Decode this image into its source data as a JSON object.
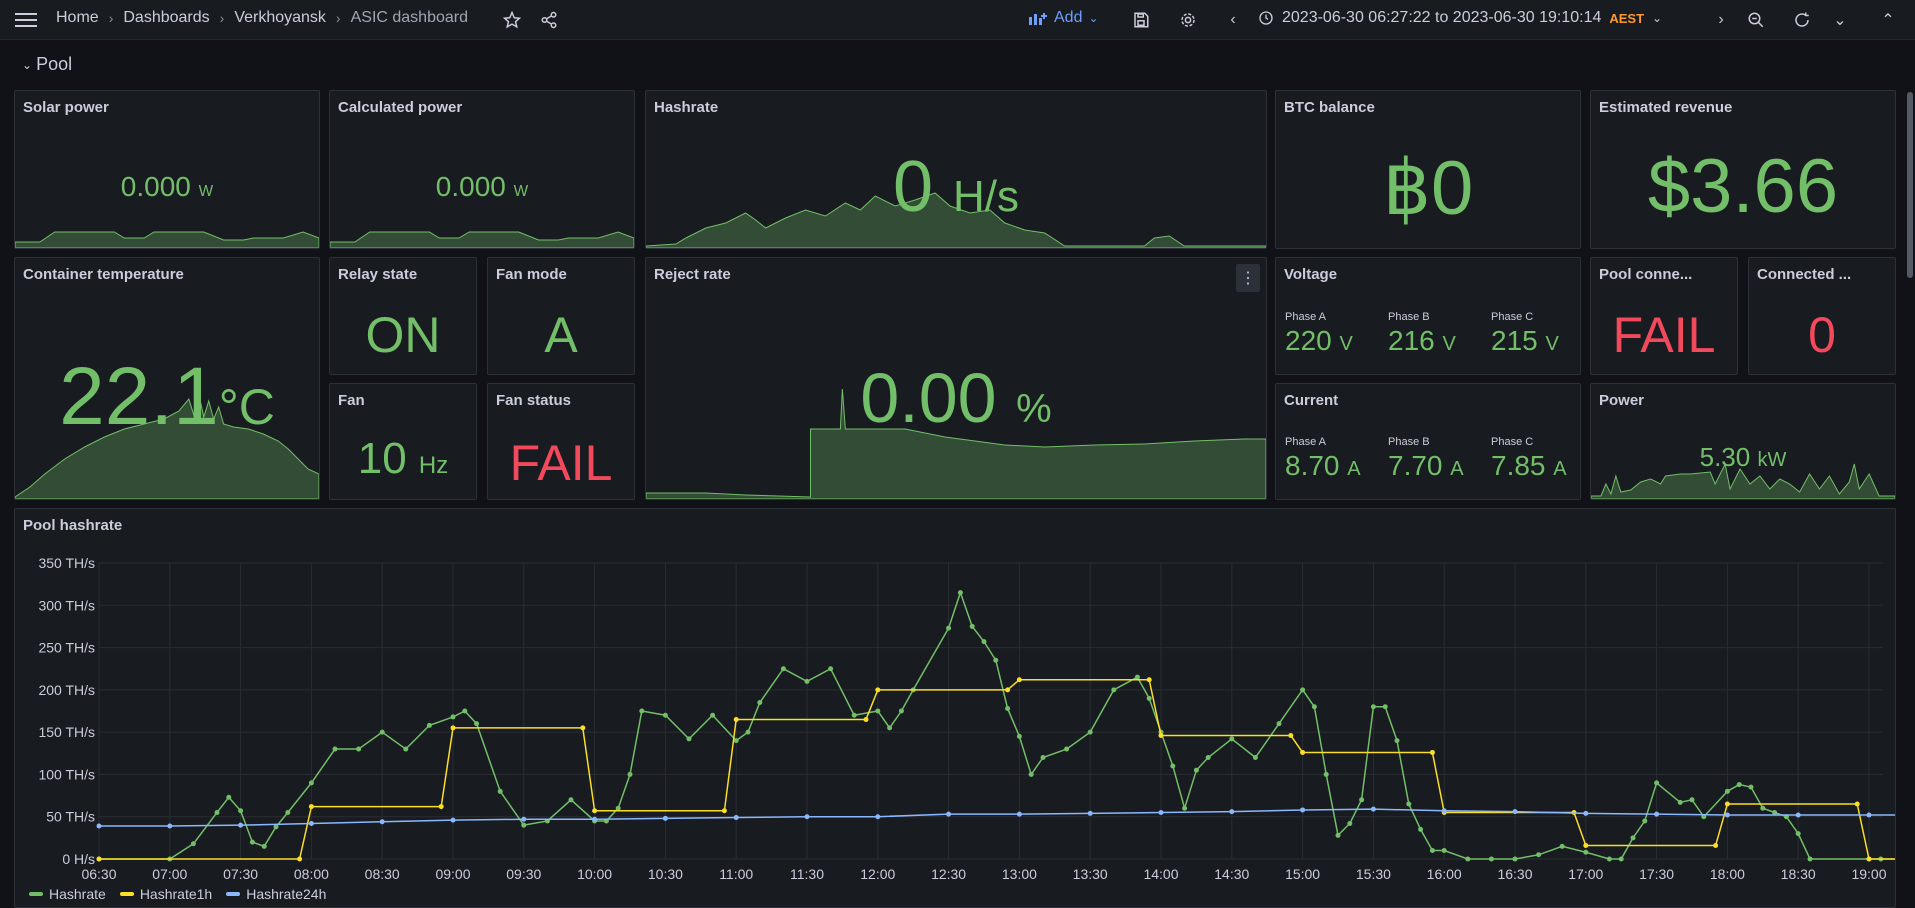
{
  "topbar": {
    "breadcrumbs": [
      "Home",
      "Dashboards",
      "Verkhoyansk",
      "ASIC dashboard"
    ],
    "add_label": "Add",
    "time_range": "2023-06-30 06:27:22 to 2023-06-30 19:10:14",
    "timezone": "AEST"
  },
  "row": {
    "title": "Pool"
  },
  "panels": {
    "solar_power": {
      "title": "Solar power",
      "value": "0.000",
      "unit": "W"
    },
    "calculated_power": {
      "title": "Calculated power",
      "value": "0.000",
      "unit": "W"
    },
    "hashrate": {
      "title": "Hashrate",
      "value": "0",
      "unit": "H/s"
    },
    "btc_balance": {
      "title": "BTC balance",
      "value": "฿0"
    },
    "estimated_revenue": {
      "title": "Estimated revenue",
      "value": "$3.66"
    },
    "container_temperature": {
      "title": "Container temperature",
      "value": "22.1",
      "unit": "°C"
    },
    "relay_state": {
      "title": "Relay state",
      "value": "ON"
    },
    "fan_mode": {
      "title": "Fan mode",
      "value": "A"
    },
    "fan": {
      "title": "Fan",
      "value": "10",
      "unit": "Hz"
    },
    "fan_status": {
      "title": "Fan status",
      "value": "FAIL"
    },
    "reject_rate": {
      "title": "Reject rate",
      "value": "0.00",
      "unit": "%"
    },
    "voltage": {
      "title": "Voltage",
      "phases": [
        {
          "label": "Phase A",
          "value": "220",
          "unit": "V"
        },
        {
          "label": "Phase B",
          "value": "216",
          "unit": "V"
        },
        {
          "label": "Phase C",
          "value": "215",
          "unit": "V"
        }
      ]
    },
    "current": {
      "title": "Current",
      "phases": [
        {
          "label": "Phase A",
          "value": "8.70",
          "unit": "A"
        },
        {
          "label": "Phase B",
          "value": "7.70",
          "unit": "A"
        },
        {
          "label": "Phase C",
          "value": "7.85",
          "unit": "A"
        }
      ]
    },
    "pool_connection": {
      "title": "Pool conne...",
      "value": "FAIL"
    },
    "connected": {
      "title": "Connected ...",
      "value": "0"
    },
    "power": {
      "title": "Power",
      "value": "5.30",
      "unit": "kW"
    }
  },
  "colors": {
    "green": "#73bf69",
    "red": "#f2495c",
    "yellow": "#fade2a",
    "blue": "#8ab8ff",
    "accent": "#6e9fff"
  },
  "chart_data": {
    "type": "line",
    "title": "Pool hashrate",
    "ylim": [
      0,
      350
    ],
    "yticks": [
      "0 H/s",
      "50 TH/s",
      "100 TH/s",
      "150 TH/s",
      "200 TH/s",
      "250 TH/s",
      "300 TH/s",
      "350 TH/s"
    ],
    "xticks": [
      "06:30",
      "07:00",
      "07:30",
      "08:00",
      "08:30",
      "09:00",
      "09:30",
      "10:00",
      "10:30",
      "11:00",
      "11:30",
      "12:00",
      "12:30",
      "13:00",
      "13:30",
      "14:00",
      "14:30",
      "15:00",
      "15:30",
      "16:00",
      "16:30",
      "17:00",
      "17:30",
      "18:00",
      "18:30",
      "19:00"
    ],
    "series": [
      {
        "name": "Hashrate",
        "color": "#73bf69",
        "points": [
          [
            "06:30",
            0
          ],
          [
            "07:00",
            0
          ],
          [
            "07:10",
            18
          ],
          [
            "07:20",
            55
          ],
          [
            "07:25",
            73
          ],
          [
            "07:30",
            57
          ],
          [
            "07:35",
            20
          ],
          [
            "07:40",
            15
          ],
          [
            "07:45",
            38
          ],
          [
            "07:50",
            55
          ],
          [
            "08:00",
            90
          ],
          [
            "08:10",
            130
          ],
          [
            "08:20",
            130
          ],
          [
            "08:30",
            150
          ],
          [
            "08:40",
            130
          ],
          [
            "08:50",
            158
          ],
          [
            "09:00",
            168
          ],
          [
            "09:05",
            175
          ],
          [
            "09:10",
            160
          ],
          [
            "09:20",
            80
          ],
          [
            "09:30",
            40
          ],
          [
            "09:40",
            45
          ],
          [
            "09:50",
            70
          ],
          [
            "10:00",
            45
          ],
          [
            "10:05",
            45
          ],
          [
            "10:10",
            60
          ],
          [
            "10:15",
            100
          ],
          [
            "10:20",
            175
          ],
          [
            "10:30",
            170
          ],
          [
            "10:40",
            142
          ],
          [
            "10:50",
            170
          ],
          [
            "11:00",
            140
          ],
          [
            "11:05",
            150
          ],
          [
            "11:10",
            185
          ],
          [
            "11:20",
            225
          ],
          [
            "11:30",
            210
          ],
          [
            "11:40",
            225
          ],
          [
            "11:50",
            170
          ],
          [
            "12:00",
            175
          ],
          [
            "12:05",
            155
          ],
          [
            "12:10",
            175
          ],
          [
            "12:15",
            200
          ],
          [
            "12:30",
            273
          ],
          [
            "12:35",
            315
          ],
          [
            "12:40",
            275
          ],
          [
            "12:45",
            257
          ],
          [
            "12:50",
            235
          ],
          [
            "12:55",
            178
          ],
          [
            "13:00",
            145
          ],
          [
            "13:05",
            100
          ],
          [
            "13:10",
            120
          ],
          [
            "13:20",
            130
          ],
          [
            "13:30",
            150
          ],
          [
            "13:40",
            200
          ],
          [
            "13:50",
            215
          ],
          [
            "13:55",
            190
          ],
          [
            "14:00",
            150
          ],
          [
            "14:05",
            110
          ],
          [
            "14:10",
            60
          ],
          [
            "14:15",
            105
          ],
          [
            "14:20",
            120
          ],
          [
            "14:30",
            142
          ],
          [
            "14:40",
            120
          ],
          [
            "14:50",
            160
          ],
          [
            "15:00",
            200
          ],
          [
            "15:05",
            180
          ],
          [
            "15:10",
            100
          ],
          [
            "15:15",
            28
          ],
          [
            "15:20",
            42
          ],
          [
            "15:25",
            70
          ],
          [
            "15:30",
            180
          ],
          [
            "15:35",
            180
          ],
          [
            "15:40",
            140
          ],
          [
            "15:45",
            65
          ],
          [
            "15:50",
            35
          ],
          [
            "15:55",
            10
          ],
          [
            "16:00",
            10
          ],
          [
            "16:10",
            0
          ],
          [
            "16:20",
            0
          ],
          [
            "16:30",
            0
          ],
          [
            "16:40",
            5
          ],
          [
            "16:50",
            15
          ],
          [
            "17:00",
            8
          ],
          [
            "17:10",
            0
          ],
          [
            "17:15",
            0
          ],
          [
            "17:20",
            25
          ],
          [
            "17:25",
            45
          ],
          [
            "17:30",
            90
          ],
          [
            "17:40",
            67
          ],
          [
            "17:45",
            70
          ],
          [
            "17:50",
            50
          ],
          [
            "18:00",
            80
          ],
          [
            "18:05",
            88
          ],
          [
            "18:10",
            85
          ],
          [
            "18:15",
            60
          ],
          [
            "18:20",
            55
          ],
          [
            "18:25",
            50
          ],
          [
            "18:30",
            30
          ],
          [
            "18:35",
            0
          ],
          [
            "19:00",
            0
          ],
          [
            "19:05",
            0
          ],
          [
            "19:15",
            0
          ]
        ]
      },
      {
        "name": "Hashrate1h",
        "color": "#fade2a",
        "points": [
          [
            "06:30",
            0
          ],
          [
            "07:55",
            0
          ],
          [
            "08:00",
            62
          ],
          [
            "08:55",
            62
          ],
          [
            "09:00",
            155
          ],
          [
            "09:55",
            155
          ],
          [
            "10:00",
            57
          ],
          [
            "10:55",
            57
          ],
          [
            "11:00",
            165
          ],
          [
            "11:55",
            165
          ],
          [
            "12:00",
            200
          ],
          [
            "12:55",
            200
          ],
          [
            "13:00",
            212
          ],
          [
            "13:55",
            212
          ],
          [
            "14:00",
            146
          ],
          [
            "14:55",
            146
          ],
          [
            "15:00",
            126
          ],
          [
            "15:55",
            126
          ],
          [
            "16:00",
            55
          ],
          [
            "16:55",
            55
          ],
          [
            "17:00",
            16
          ],
          [
            "17:55",
            16
          ],
          [
            "18:00",
            65
          ],
          [
            "18:55",
            65
          ],
          [
            "19:00",
            0
          ],
          [
            "19:15",
            0
          ]
        ]
      },
      {
        "name": "Hashrate24h",
        "color": "#8ab8ff",
        "points": [
          [
            "06:30",
            39
          ],
          [
            "07:00",
            39
          ],
          [
            "07:30",
            40
          ],
          [
            "08:00",
            42
          ],
          [
            "08:30",
            44
          ],
          [
            "09:00",
            46
          ],
          [
            "09:30",
            47
          ],
          [
            "10:00",
            47
          ],
          [
            "10:30",
            48
          ],
          [
            "11:00",
            49
          ],
          [
            "11:30",
            50
          ],
          [
            "12:00",
            50
          ],
          [
            "12:30",
            53
          ],
          [
            "13:00",
            53
          ],
          [
            "13:30",
            54
          ],
          [
            "14:00",
            55
          ],
          [
            "14:30",
            56
          ],
          [
            "15:00",
            58
          ],
          [
            "15:30",
            59
          ],
          [
            "16:00",
            57
          ],
          [
            "16:30",
            56
          ],
          [
            "17:00",
            54
          ],
          [
            "17:30",
            53
          ],
          [
            "18:00",
            52
          ],
          [
            "18:30",
            52
          ],
          [
            "19:00",
            52
          ],
          [
            "19:15",
            52
          ]
        ]
      }
    ],
    "legend_position": "bottom-left"
  }
}
